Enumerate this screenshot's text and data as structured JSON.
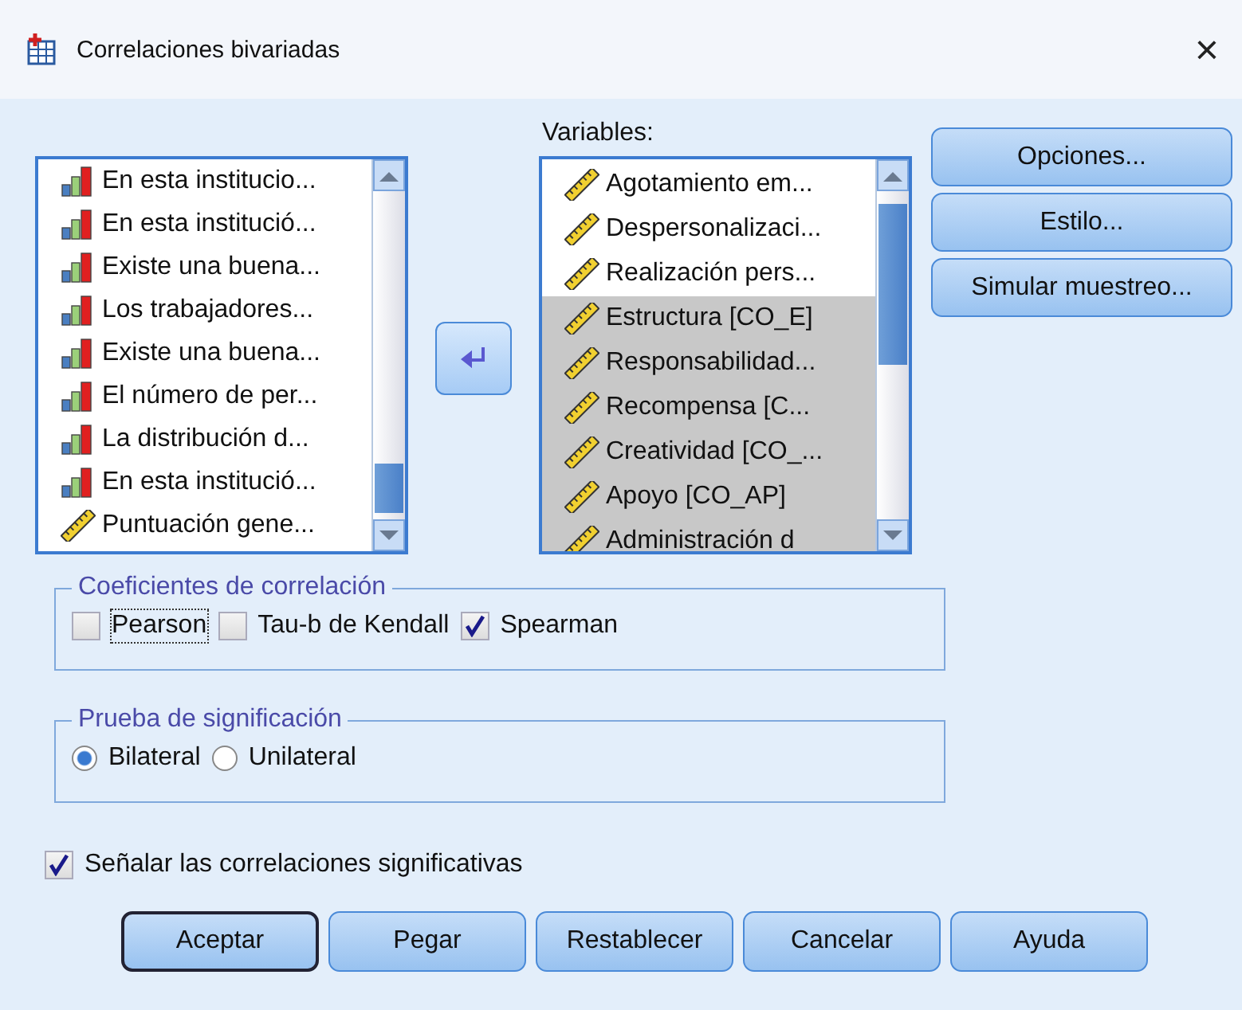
{
  "window": {
    "title": "Correlaciones bivariadas",
    "close": "×"
  },
  "source_list": {
    "items": [
      {
        "label": "En esta institucio...",
        "kind": "ordinal",
        "selected": false
      },
      {
        "label": "En esta institució...",
        "kind": "ordinal",
        "selected": false
      },
      {
        "label": "Existe una buena...",
        "kind": "ordinal",
        "selected": false
      },
      {
        "label": "Los trabajadores...",
        "kind": "ordinal",
        "selected": false
      },
      {
        "label": "Existe una buena...",
        "kind": "ordinal",
        "selected": false
      },
      {
        "label": "El número de per...",
        "kind": "ordinal",
        "selected": false
      },
      {
        "label": "La distribución d...",
        "kind": "ordinal",
        "selected": false
      },
      {
        "label": "En esta institució...",
        "kind": "ordinal",
        "selected": false
      },
      {
        "label": "Puntuación gene...",
        "kind": "scale",
        "selected": false
      }
    ]
  },
  "variables": {
    "label": "Variables:",
    "items": [
      {
        "label": "Agotamiento em...",
        "kind": "scale",
        "selected": false
      },
      {
        "label": "Despersonalizaci...",
        "kind": "scale",
        "selected": false
      },
      {
        "label": "Realización pers...",
        "kind": "scale",
        "selected": false
      },
      {
        "label": "Estructura [CO_E]",
        "kind": "scale",
        "selected": true
      },
      {
        "label": "Responsabilidad...",
        "kind": "scale",
        "selected": true
      },
      {
        "label": "Recompensa [C...",
        "kind": "scale",
        "selected": true
      },
      {
        "label": "Creatividad [CO_...",
        "kind": "scale",
        "selected": true
      },
      {
        "label": "Apoyo [CO_AP]",
        "kind": "scale",
        "selected": true
      },
      {
        "label": "Administración d",
        "kind": "scale",
        "selected": true
      }
    ]
  },
  "side_buttons": [
    "Opciones...",
    "Estilo...",
    "Simular muestreo..."
  ],
  "coefficients": {
    "title": "Coeficientes de correlación",
    "options": [
      {
        "label": "Pearson",
        "checked": false,
        "focused": true
      },
      {
        "label": "Tau-b de Kendall",
        "checked": false,
        "focused": false
      },
      {
        "label": "Spearman",
        "checked": true,
        "focused": false
      }
    ]
  },
  "significance": {
    "title": "Prueba de significación",
    "options": [
      {
        "label": "Bilateral",
        "selected": true
      },
      {
        "label": "Unilateral",
        "selected": false
      }
    ]
  },
  "flag_significant": {
    "label": "Señalar las correlaciones significativas",
    "checked": true
  },
  "buttons": [
    {
      "label": "Aceptar",
      "default": true
    },
    {
      "label": "Pegar",
      "default": false
    },
    {
      "label": "Restablecer",
      "default": false
    },
    {
      "label": "Cancelar",
      "default": false
    },
    {
      "label": "Ayuda",
      "default": false
    }
  ]
}
